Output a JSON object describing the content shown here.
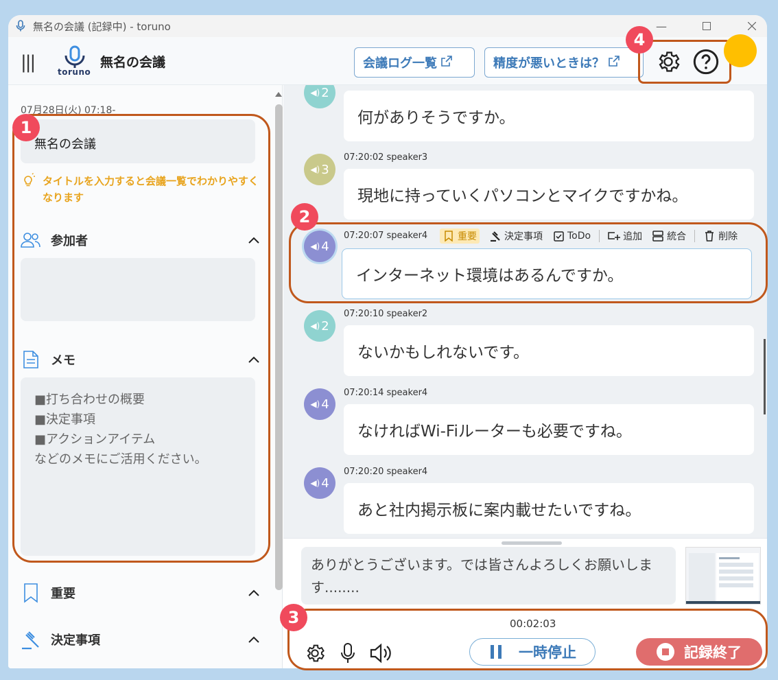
{
  "window": {
    "title": "無名の会議 (記録中) - toruno"
  },
  "header": {
    "logo_text": "toruno",
    "meeting_title": "無名の会議",
    "log_list_label": "会議ログ一覧",
    "accuracy_help_label": "精度が悪いときは？"
  },
  "sidebar": {
    "date": "07月28日(火) 07:18-",
    "title_value": "無名の会議",
    "hint": "タイトルを入力すると会議一覧でわかりやすくなります",
    "participants_label": "参加者",
    "memo_label": "メモ",
    "memo_placeholder": [
      "■打ち合わせの概要",
      "■決定事項",
      "■アクションアイテム",
      "などのメモにご活用ください。"
    ],
    "important_label": "重要",
    "decisions_label": "決定事項"
  },
  "messages": [
    {
      "speaker_num": "2",
      "color": "#8fd3d0",
      "meta": "",
      "text": "何がありそうですか。"
    },
    {
      "speaker_num": "3",
      "color": "#c9c98b",
      "meta": "07:20:02 speaker3",
      "text": "現地に持っていくパソコンとマイクですかね。"
    },
    {
      "speaker_num": "4",
      "color": "#8c8fd2",
      "meta": "07:20:07 speaker4",
      "text": "インターネット環境はあるんですか。"
    },
    {
      "speaker_num": "2",
      "color": "#8fd3d0",
      "meta": "07:20:10 speaker2",
      "text": "ないかもしれないです。"
    },
    {
      "speaker_num": "4",
      "color": "#8c8fd2",
      "meta": "07:20:14 speaker4",
      "text": "なければWi-Fiルーターも必要ですね。"
    },
    {
      "speaker_num": "4",
      "color": "#8c8fd2",
      "meta": "07:20:20 speaker4",
      "text": "あと社内掲示板に案内載せたいですね。"
    }
  ],
  "message_toolbar": {
    "important": "重要",
    "decision": "決定事項",
    "todo": "ToDo",
    "add": "追加",
    "merge": "統合",
    "delete": "削除"
  },
  "live_transcript": "ありがとうございます。では皆さんよろしくお願いします........",
  "footer": {
    "timer": "00:02:03",
    "pause_label": "一時停止",
    "stop_label": "記録終了"
  },
  "annotations": [
    "1",
    "2",
    "3",
    "4"
  ],
  "colors": {
    "accent": "#3d7ab8",
    "highlight": "#c0581c",
    "badge": "#f04a5c",
    "stop": "#e06d6d",
    "avatar": "#ffbf00"
  }
}
